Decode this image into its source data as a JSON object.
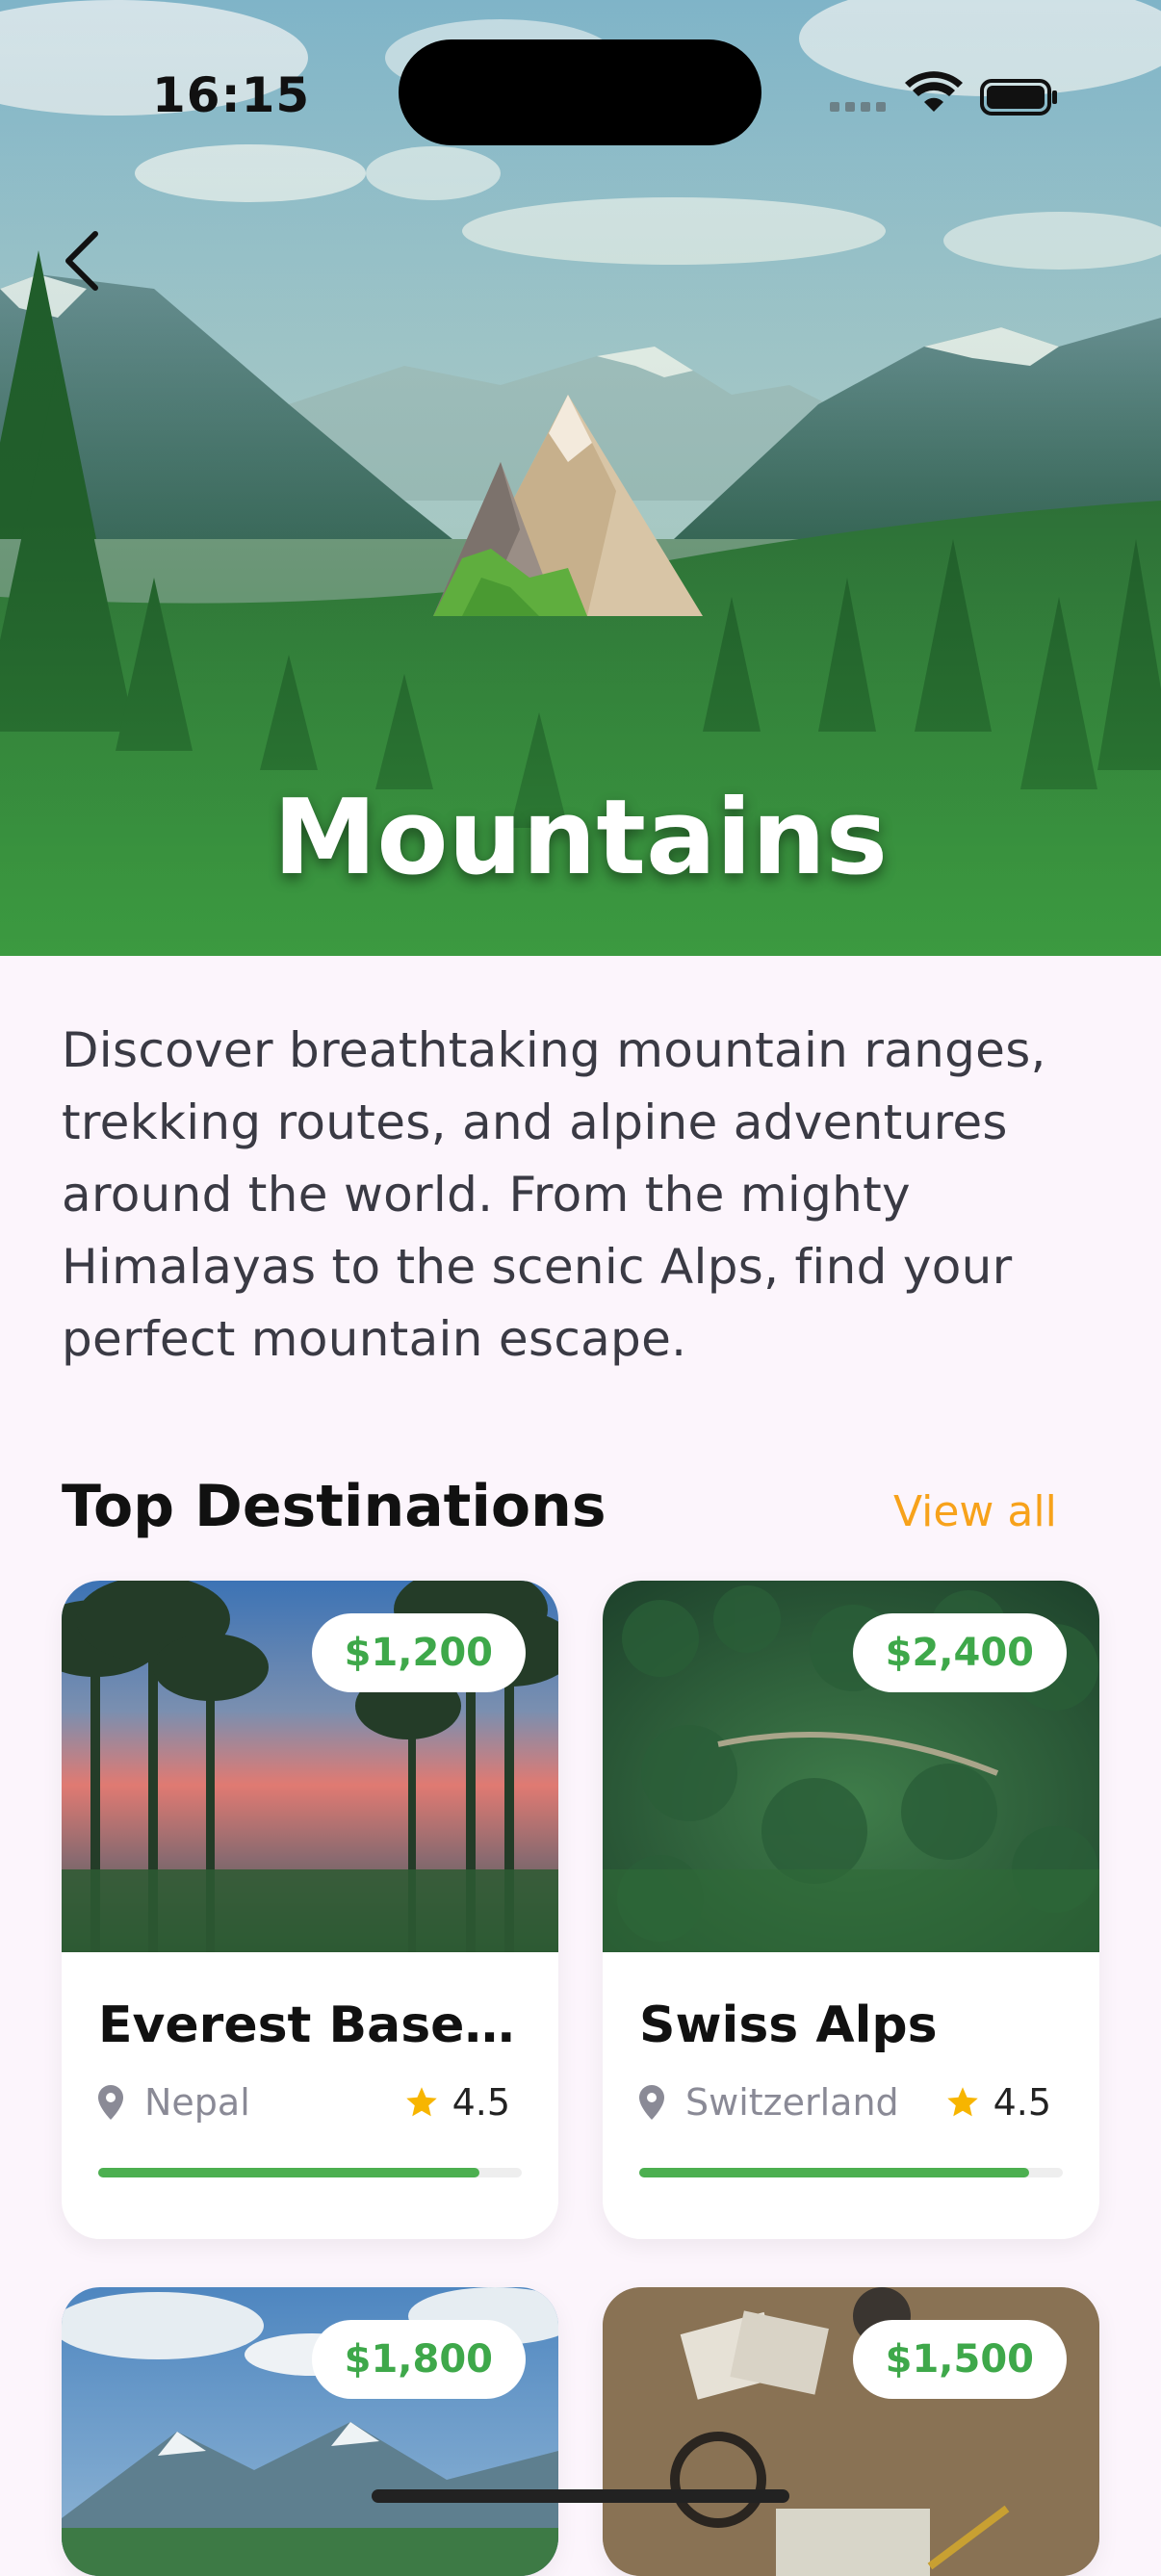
{
  "status_bar": {
    "time": "16:15"
  },
  "hero": {
    "title": "Mountains",
    "emoji": "mountain-emoji"
  },
  "description": "Discover breathtaking mountain ranges, trekking routes, and alpine adventures around the world. From the mighty Himalayas to the scenic Alps, find your perfect mountain escape.",
  "section": {
    "title": "Top Destinations",
    "view_all": "View all"
  },
  "destinations": [
    {
      "name": "Everest Base Ca...",
      "location": "Nepal",
      "rating": "4.5",
      "price": "$1,200",
      "progress": 0.9
    },
    {
      "name": "Swiss Alps",
      "location": "Switzerland",
      "rating": "4.5",
      "price": "$2,400",
      "progress": 0.92
    },
    {
      "price": "$1,800"
    },
    {
      "price": "$1,500"
    }
  ],
  "colors": {
    "accent": "#f7a21b",
    "price_green": "#3ea84a",
    "progress_green": "#4caf50",
    "background": "#fcf5fc"
  }
}
